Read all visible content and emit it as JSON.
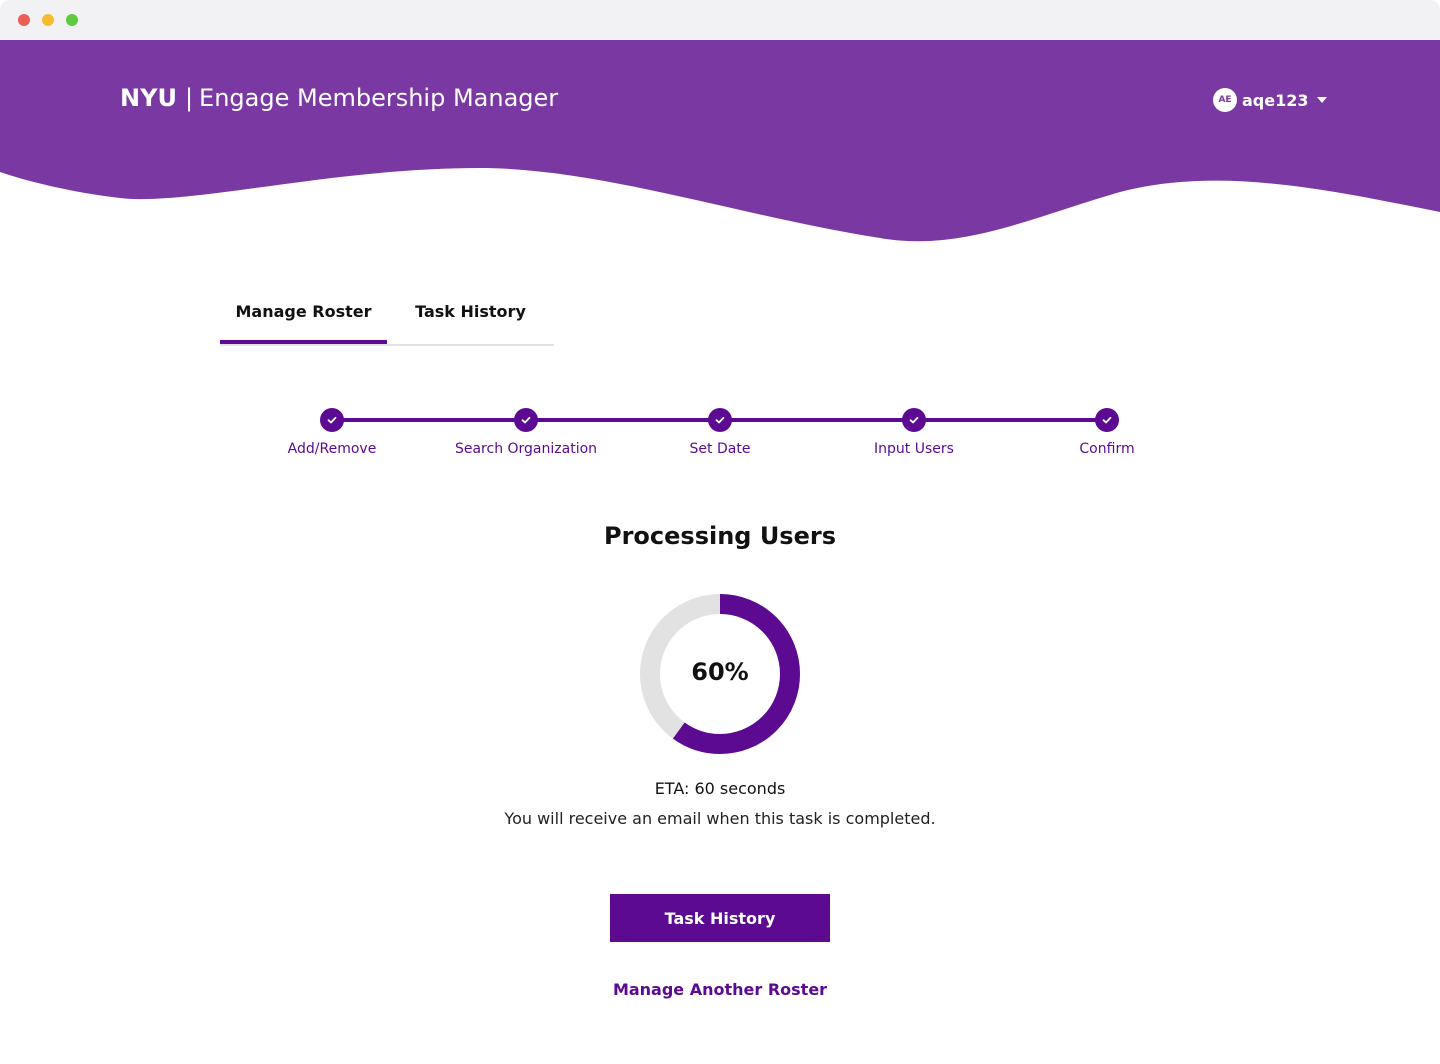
{
  "window": {
    "controls": [
      "close",
      "minimize",
      "maximize"
    ]
  },
  "header": {
    "brand": "NYU",
    "separator": "|",
    "app_name": "Engage Membership Manager",
    "background_color": "#7a38a3",
    "user": {
      "initials": "AE",
      "username": "aqe123",
      "menu_icon": "caret-down-icon"
    }
  },
  "tabs": [
    {
      "label": "Manage Roster",
      "active": true
    },
    {
      "label": "Task History",
      "active": false
    }
  ],
  "stepper": {
    "accent_color": "#5b0a91",
    "steps": [
      {
        "label": "Add/Remove",
        "completed": true
      },
      {
        "label": "Search Organization",
        "completed": true
      },
      {
        "label": "Set Date",
        "completed": true
      },
      {
        "label": "Input Users",
        "completed": true
      },
      {
        "label": "Confirm",
        "completed": true
      }
    ]
  },
  "processing": {
    "title": "Processing Users",
    "progress": 0.6,
    "progress_label": "60%",
    "eta": "ETA: 60 seconds",
    "note": "You will receive an email when this task is completed."
  },
  "actions": {
    "task_history_button": "Task History",
    "manage_another_link": "Manage Another Roster"
  }
}
